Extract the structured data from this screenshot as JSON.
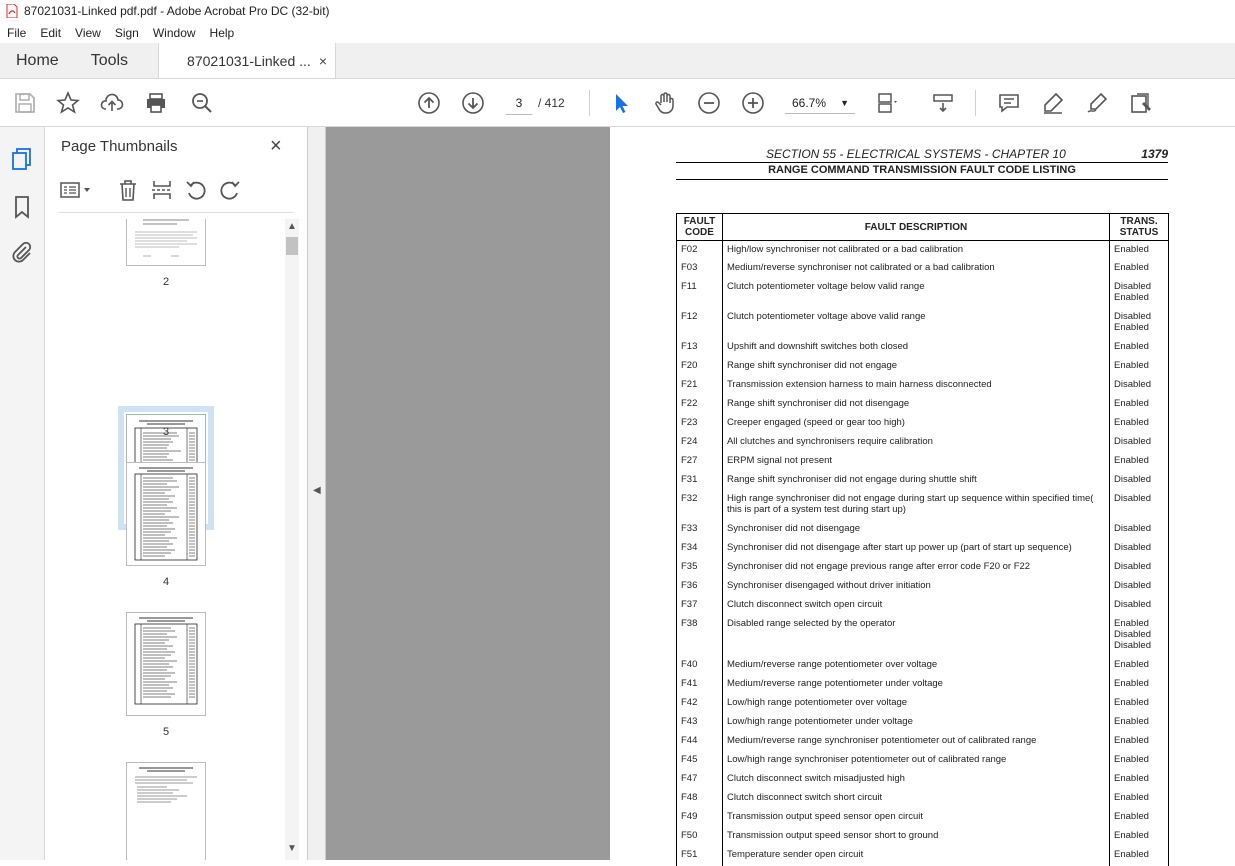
{
  "window": {
    "title": "87021031-Linked pdf.pdf - Adobe Acrobat Pro DC (32-bit)"
  },
  "menu": [
    "File",
    "Edit",
    "View",
    "Sign",
    "Window",
    "Help"
  ],
  "tabs": {
    "home": "Home",
    "tools": "Tools",
    "document": "87021031-Linked ...",
    "close": "×"
  },
  "toolbar": {
    "current_page": "3",
    "page_total": "/ 412",
    "zoom": "66.7%"
  },
  "thumbnails": {
    "title": "Page Thumbnails",
    "close": "×",
    "pages": [
      {
        "label": "2"
      },
      {
        "label": "3"
      },
      {
        "label": "4"
      },
      {
        "label": "5"
      }
    ]
  },
  "document": {
    "section": "SECTION 55 - ELECTRICAL SYSTEMS - CHAPTER 10",
    "page_number": "1379",
    "heading": "RANGE COMMAND TRANSMISSION FAULT CODE LISTING",
    "columns": {
      "code": "FAULT CODE",
      "description": "FAULT DESCRIPTION",
      "status": "TRANS. STATUS"
    },
    "rows": [
      {
        "code": "F02",
        "desc": "High/low synchroniser not calibrated or a bad calibration",
        "status": [
          "Enabled"
        ]
      },
      {
        "code": "F03",
        "desc": "Medium/reverse synchroniser not calibrated or a bad calibration",
        "status": [
          "Enabled"
        ]
      },
      {
        "code": "F11",
        "desc": "Clutch potentiometer voltage below valid range",
        "status": [
          "Disabled",
          "Enabled"
        ]
      },
      {
        "code": "F12",
        "desc": "Clutch potentiometer voltage above valid range",
        "status": [
          "Disabled",
          "Enabled"
        ]
      },
      {
        "code": "F13",
        "desc": "Upshift and downshift switches both closed",
        "status": [
          "Enabled"
        ]
      },
      {
        "code": "F20",
        "desc": "Range shift synchroniser did not engage",
        "status": [
          "Enabled"
        ]
      },
      {
        "code": "F21",
        "desc": "Transmission extension harness to main harness disconnected",
        "status": [
          "Disabled"
        ]
      },
      {
        "code": "F22",
        "desc": "Range shift synchroniser did not disengage",
        "status": [
          "Enabled"
        ]
      },
      {
        "code": "F23",
        "desc": "Creeper engaged (speed or gear too high)",
        "status": [
          "Enabled"
        ]
      },
      {
        "code": "F24",
        "desc": "All clutches and synchronisers require calibration",
        "status": [
          "Disabled"
        ]
      },
      {
        "code": "F27",
        "desc": "ERPM signal not present",
        "status": [
          "Enabled"
        ]
      },
      {
        "code": "F31",
        "desc": "Range shift synchroniser did not engage during shuttle shift",
        "status": [
          "Disabled"
        ]
      },
      {
        "code": "F32",
        "desc": "High range synchroniser did not engage during start up sequence within specified time( this is part of a system test during start up)",
        "status": [
          "Disabled"
        ]
      },
      {
        "code": "F33",
        "desc": "Synchroniser did not disengage",
        "status": [
          "Disabled"
        ]
      },
      {
        "code": "F34",
        "desc": "Synchroniser did not disengage after start up power up (part of start up sequence)",
        "status": [
          "Disabled"
        ]
      },
      {
        "code": "F35",
        "desc": "Synchroniser did not engage previous range after error code F20 or F22",
        "status": [
          "Disabled"
        ]
      },
      {
        "code": "F36",
        "desc": "Synchroniser disengaged without driver initiation",
        "status": [
          "Disabled"
        ]
      },
      {
        "code": "F37",
        "desc": "Clutch disconnect switch open circuit",
        "status": [
          "Disabled"
        ]
      },
      {
        "code": "F38",
        "desc": "Disabled range selected by the operator",
        "status": [
          "Enabled",
          "Disabled",
          "Disabled"
        ]
      },
      {
        "code": "F40",
        "desc": "Medium/reverse range potentiometer over voltage",
        "status": [
          "Enabled"
        ]
      },
      {
        "code": "F41",
        "desc": "Medium/reverse range potentiometer under voltage",
        "status": [
          "Enabled"
        ]
      },
      {
        "code": "F42",
        "desc": "Low/high range potentiometer over voltage",
        "status": [
          "Enabled"
        ]
      },
      {
        "code": "F43",
        "desc": "Low/high range potentiometer under voltage",
        "status": [
          "Enabled"
        ]
      },
      {
        "code": "F44",
        "desc": "Medium/reverse range synchroniser potentiometer out of calibrated range",
        "status": [
          "Enabled"
        ]
      },
      {
        "code": "F45",
        "desc": "Low/high range synchroniser potentiometer out of calibrated range",
        "status": [
          "Enabled"
        ]
      },
      {
        "code": "F47",
        "desc": "Clutch disconnect switch misadjusted high",
        "status": [
          "Enabled"
        ]
      },
      {
        "code": "F48",
        "desc": "Clutch disconnect switch short circuit",
        "status": [
          "Enabled"
        ]
      },
      {
        "code": "F49",
        "desc": "Transmission output speed sensor open circuit",
        "status": [
          "Enabled"
        ]
      },
      {
        "code": "F50",
        "desc": "Transmission output speed sensor short to ground",
        "status": [
          "Enabled"
        ]
      },
      {
        "code": "F51",
        "desc": "Temperature sender open circuit",
        "status": [
          "Enabled"
        ]
      }
    ]
  }
}
